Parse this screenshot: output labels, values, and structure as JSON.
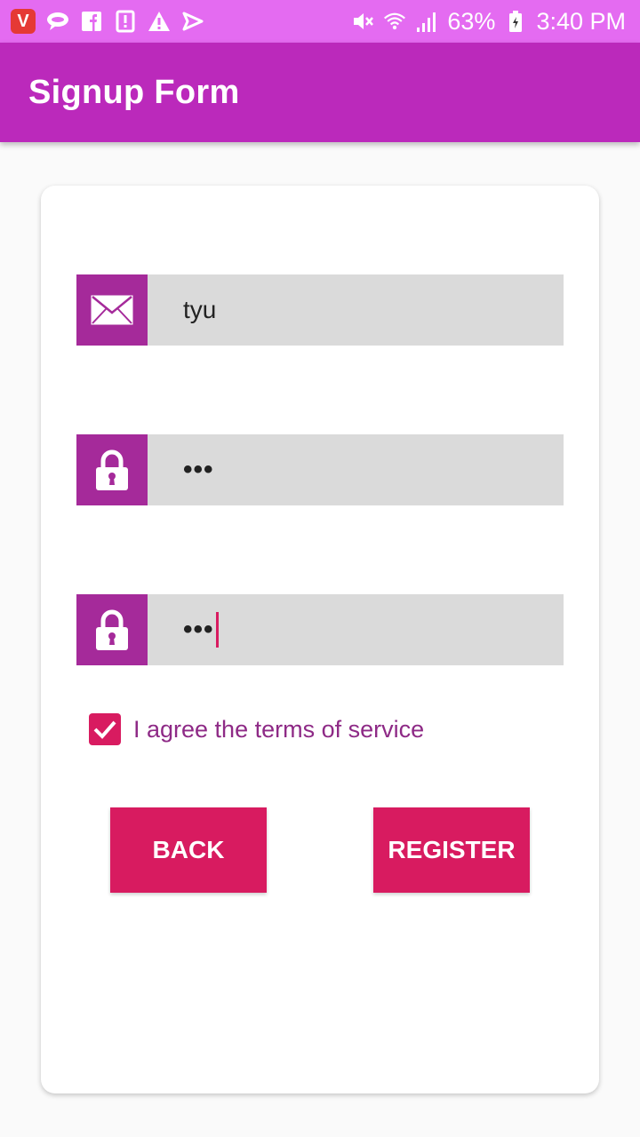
{
  "status_bar": {
    "battery": "63%",
    "time": "3:40 PM",
    "icons_left": [
      "vivo-icon",
      "chat-bubble-icon",
      "facebook-icon",
      "notification-icon",
      "warning-icon",
      "send-icon"
    ],
    "icons_right": [
      "mute-icon",
      "wifi-icon",
      "signal-icon",
      "battery-icon"
    ]
  },
  "toolbar": {
    "title": "Signup Form"
  },
  "form": {
    "email": {
      "value": "tyu",
      "icon": "envelope-icon"
    },
    "password": {
      "value": "•••",
      "icon": "lock-icon"
    },
    "confirm_password": {
      "value": "•••",
      "icon": "lock-icon"
    },
    "terms": {
      "label": "I agree the terms of service",
      "checked": true
    },
    "back_label": "BACK",
    "register_label": "REGISTER"
  },
  "colors": {
    "status_bar": "#e46bf1",
    "toolbar": "#bb29bb",
    "icon_block": "#a52a9a",
    "input_bg": "#dadada",
    "accent": "#d81b60",
    "terms_text": "#8e2a86"
  }
}
